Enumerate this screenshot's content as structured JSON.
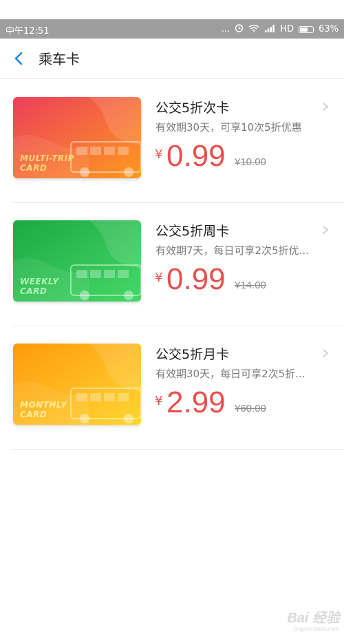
{
  "status_bar": {
    "time": "中午12:51",
    "dots": "...",
    "network": "HD",
    "battery_percent": 63,
    "battery_label": "63%"
  },
  "header": {
    "title": "乘车卡"
  },
  "cards": [
    {
      "name": "公交5折次卡",
      "description": "有效期30天，可享10次5折优惠",
      "currency": "¥",
      "price": "0.99",
      "original_price": "¥10.00",
      "card_label_line1": "MULTI-TRIP",
      "card_label_line2": "CARD",
      "colors": {
        "from": "#ec3f5b",
        "to": "#ff9a1d"
      }
    },
    {
      "name": "公交5折周卡",
      "description": "有效期7天，每日可享2次5折优...",
      "currency": "¥",
      "price": "0.99",
      "original_price": "¥14.00",
      "card_label_line1": "WEEKLY",
      "card_label_line2": "CARD",
      "colors": {
        "from": "#1ba944",
        "to": "#45d866"
      }
    },
    {
      "name": "公交5折月卡",
      "description": "有效期30天，每日可享2次5折...",
      "currency": "¥",
      "price": "2.99",
      "original_price": "¥60.00",
      "card_label_line1": "MONTHLY",
      "card_label_line2": "CARD",
      "colors": {
        "from": "#ff9a0d",
        "to": "#ffd633"
      }
    }
  ],
  "watermark": {
    "text": "Bai 经验",
    "sub": "jingyan.baidu.com"
  }
}
